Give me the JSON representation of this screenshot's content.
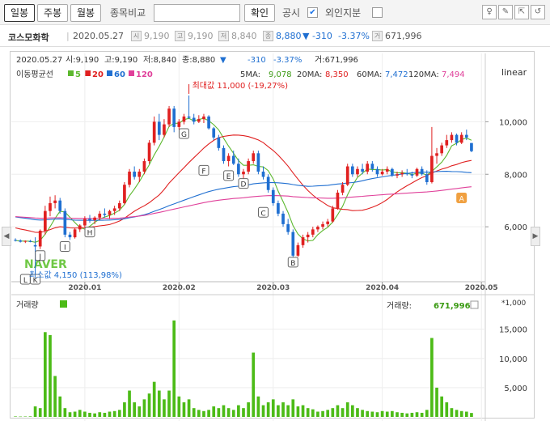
{
  "toolbar": {
    "tabs": [
      "일봉",
      "주봉",
      "월봉"
    ],
    "compare_label": "종목비교",
    "confirm_label": "확인",
    "disclosure_label": "공시",
    "foreign_label": "외인지분"
  },
  "info": {
    "name": "코스모화학",
    "date": "2020.05.27",
    "open": "9,190",
    "high": "9,190",
    "low": "8,840",
    "close": "8,880",
    "change": "▼ -310",
    "change_pct": "-3.37%",
    "volume": "671,996"
  },
  "chart_header": {
    "date": "2020.05.27",
    "open_text": "시:9,190",
    "high_text": "고:9,190",
    "low_text": "저:8,840",
    "close_text": "종:8,880",
    "arrow": "▼",
    "change": "-310",
    "change_pct": "-3.37%",
    "volume_text": "거:671,996",
    "scale_mode": "linear"
  },
  "ma_legend": {
    "title": "이동평균선",
    "items": [
      {
        "label": "5",
        "color": "#5cb82e"
      },
      {
        "label": "20",
        "color": "#e02020"
      },
      {
        "label": "60",
        "color": "#1f6fd1"
      },
      {
        "label": "120",
        "color": "#e0409a"
      }
    ],
    "values": [
      {
        "label": "5MA:",
        "value": "9,078",
        "color": "#3a9a12"
      },
      {
        "label": "20MA:",
        "value": "8,350",
        "color": "#e02020"
      },
      {
        "label": "60MA:",
        "value": "7,472",
        "color": "#1f6fd1"
      },
      {
        "label": "120MA:",
        "value": "7,494",
        "color": "#e0409a"
      }
    ]
  },
  "annotations": {
    "max_label": "최대값 11,000 (-19,27%)",
    "min_label": "최소값 4,150 (113,98%)",
    "watermark": "NAVER"
  },
  "volume_panel": {
    "title": "거래량",
    "value_label": "거래량:",
    "value": "671,996",
    "unit": "*1,000"
  },
  "chart_data": [
    {
      "type": "candlestick",
      "title": "",
      "ylim": [
        4000,
        11800
      ],
      "y_ticks": [
        6000,
        8000,
        10000
      ],
      "y_tick_labels": [
        "6,000",
        "8,000",
        "10,000"
      ],
      "x_tick_labels": [
        "2020.01",
        "2020.02",
        "2020.03",
        "2020.04",
        "2020.05"
      ],
      "x_tick_index": [
        14,
        33,
        52,
        74,
        94
      ],
      "ohlc": [
        [
          5500,
          5560,
          5440,
          5480
        ],
        [
          5480,
          5520,
          5400,
          5430
        ],
        [
          5430,
          5480,
          5380,
          5460
        ],
        [
          5460,
          5500,
          5410,
          5420
        ],
        [
          5300,
          5600,
          4150,
          5250
        ],
        [
          5250,
          5900,
          5150,
          5850
        ],
        [
          5850,
          6800,
          5700,
          6600
        ],
        [
          6600,
          7150,
          6400,
          6900
        ],
        [
          6900,
          7200,
          6700,
          7000
        ],
        [
          7000,
          7100,
          6500,
          6600
        ],
        [
          6600,
          6700,
          5600,
          5700
        ],
        [
          5700,
          5800,
          5500,
          5600
        ],
        [
          5600,
          5950,
          5550,
          5900
        ],
        [
          5900,
          6100,
          5800,
          6050
        ],
        [
          6050,
          6400,
          5950,
          6300
        ],
        [
          6300,
          6450,
          6150,
          6250
        ],
        [
          6250,
          6400,
          6100,
          6350
        ],
        [
          6350,
          6600,
          6250,
          6500
        ],
        [
          6500,
          6700,
          6350,
          6450
        ],
        [
          6450,
          6650,
          6300,
          6600
        ],
        [
          6600,
          6800,
          6450,
          6700
        ],
        [
          6700,
          7000,
          6600,
          6900
        ],
        [
          6900,
          7700,
          6850,
          7600
        ],
        [
          7600,
          8200,
          7500,
          8100
        ],
        [
          8100,
          8300,
          7800,
          7900
        ],
        [
          7900,
          8200,
          7700,
          8100
        ],
        [
          8100,
          8600,
          8000,
          8500
        ],
        [
          8500,
          9300,
          8400,
          9200
        ],
        [
          9200,
          10200,
          9100,
          10000
        ],
        [
          10000,
          10300,
          9300,
          9500
        ],
        [
          9500,
          10100,
          9400,
          9900
        ],
        [
          9900,
          10600,
          9800,
          10500
        ],
        [
          10500,
          10600,
          9600,
          9800
        ],
        [
          9800,
          10100,
          9700,
          10000
        ],
        [
          10000,
          10300,
          9900,
          10200
        ],
        [
          10200,
          11000,
          10100,
          10150
        ],
        [
          10150,
          10300,
          9900,
          10000
        ],
        [
          10000,
          10250,
          9950,
          10100
        ],
        [
          10100,
          10300,
          9950,
          10200
        ],
        [
          10200,
          10250,
          9700,
          9750
        ],
        [
          9750,
          9800,
          9300,
          9400
        ],
        [
          9400,
          9500,
          8900,
          9000
        ],
        [
          9000,
          9100,
          8400,
          8500
        ],
        [
          8500,
          8800,
          8300,
          8700
        ],
        [
          8700,
          8900,
          8350,
          8400
        ],
        [
          8400,
          8600,
          7900,
          8000
        ],
        [
          8000,
          8200,
          7800,
          8100
        ],
        [
          8100,
          8600,
          8000,
          8500
        ],
        [
          8500,
          8900,
          8400,
          8800
        ],
        [
          8800,
          8900,
          8000,
          8100
        ],
        [
          8100,
          8300,
          7800,
          7900
        ],
        [
          7900,
          8000,
          7300,
          7400
        ],
        [
          7400,
          7500,
          6800,
          6900
        ],
        [
          6900,
          7000,
          6400,
          6500
        ],
        [
          6500,
          6600,
          6000,
          6100
        ],
        [
          6100,
          6300,
          5700,
          5800
        ],
        [
          5800,
          5900,
          4800,
          4900
        ],
        [
          4900,
          5400,
          4850,
          5300
        ],
        [
          5300,
          5700,
          5200,
          5600
        ],
        [
          5600,
          5800,
          5400,
          5700
        ],
        [
          5700,
          6000,
          5600,
          5900
        ],
        [
          5900,
          6050,
          5800,
          6000
        ],
        [
          6000,
          6200,
          5900,
          6100
        ],
        [
          6100,
          6300,
          6000,
          6200
        ],
        [
          6200,
          6800,
          6150,
          6700
        ],
        [
          6700,
          7400,
          6650,
          7300
        ],
        [
          7300,
          7700,
          7200,
          7600
        ],
        [
          7600,
          8400,
          7550,
          8300
        ],
        [
          8300,
          8400,
          7900,
          8000
        ],
        [
          8000,
          8300,
          7900,
          8200
        ],
        [
          8200,
          8400,
          8000,
          8100
        ],
        [
          8100,
          8500,
          8000,
          8400
        ],
        [
          8400,
          8500,
          8100,
          8200
        ],
        [
          8200,
          8300,
          7900,
          8000
        ],
        [
          8000,
          8200,
          7950,
          8100
        ],
        [
          8100,
          8300,
          8000,
          8200
        ],
        [
          8200,
          8250,
          7900,
          7950
        ],
        [
          7950,
          8100,
          7850,
          8000
        ],
        [
          8000,
          8150,
          7900,
          8050
        ],
        [
          8050,
          8200,
          7950,
          8000
        ],
        [
          8000,
          8100,
          7850,
          7950
        ],
        [
          7950,
          8250,
          7900,
          8200
        ],
        [
          8200,
          8300,
          7950,
          8000
        ],
        [
          8000,
          8150,
          7600,
          7700
        ],
        [
          7700,
          9800,
          7650,
          8700
        ],
        [
          8700,
          9000,
          8400,
          8800
        ],
        [
          8800,
          9200,
          8700,
          9100
        ],
        [
          9100,
          9500,
          9000,
          9300
        ],
        [
          9300,
          9600,
          9200,
          9500
        ],
        [
          9500,
          9550,
          9100,
          9200
        ],
        [
          9200,
          9600,
          9150,
          9500
        ],
        [
          9500,
          9700,
          9300,
          9400
        ],
        [
          9190,
          9190,
          8840,
          8880
        ]
      ],
      "volume": [
        80,
        60,
        70,
        90,
        1800,
        1500,
        14500,
        14000,
        7000,
        3500,
        1500,
        800,
        900,
        1200,
        900,
        700,
        600,
        800,
        700,
        900,
        1000,
        1200,
        2500,
        4500,
        2500,
        1800,
        3000,
        4000,
        6000,
        4500,
        3000,
        4500,
        16500,
        3500,
        2500,
        3000,
        1500,
        1200,
        1000,
        1200,
        1800,
        1500,
        2000,
        1500,
        1200,
        2000,
        1500,
        2500,
        11000,
        3500,
        2000,
        2500,
        3000,
        2000,
        2500,
        2000,
        3000,
        1800,
        2000,
        1500,
        1300,
        900,
        1000,
        1200,
        1500,
        2000,
        1500,
        2500,
        2000,
        1500,
        1200,
        1000,
        900,
        800,
        1000,
        900,
        1000,
        800,
        700,
        600,
        700,
        800,
        700,
        1200,
        13500,
        5000,
        3500,
        2500,
        1500,
        1200,
        1000,
        900,
        672
      ],
      "volume_ylim": [
        0,
        18000
      ],
      "volume_ticks": [
        5000,
        10000,
        15000
      ],
      "volume_tick_labels": [
        "5,000",
        "10,000",
        "15,000"
      ],
      "markers": [
        {
          "label": "A",
          "index": 90,
          "y": 7100,
          "filled": true
        },
        {
          "label": "B",
          "index": 56,
          "y": 4650,
          "filled": false
        },
        {
          "label": "C",
          "index": 50,
          "y": 6550,
          "filled": false
        },
        {
          "label": "D",
          "index": 46,
          "y": 7650,
          "filled": false
        },
        {
          "label": "E",
          "index": 43,
          "y": 7950,
          "filled": false
        },
        {
          "label": "F",
          "index": 38,
          "y": 8150,
          "filled": false
        },
        {
          "label": "G",
          "index": 34,
          "y": 9550,
          "filled": false
        },
        {
          "label": "H",
          "index": 15,
          "y": 5800,
          "filled": false
        },
        {
          "label": "I",
          "index": 10,
          "y": 5250,
          "filled": false
        },
        {
          "label": "J",
          "index": 5,
          "y": 4900,
          "filled": false
        },
        {
          "label": "K",
          "index": 4,
          "y": 4000,
          "filled": false
        },
        {
          "label": "L",
          "index": 2,
          "y": 4000,
          "filled": false
        }
      ],
      "max_point": {
        "index": 35,
        "value": 11000
      },
      "min_point": {
        "index": 4,
        "value": 4150
      },
      "up_color": "#e02020",
      "down_color": "#1f6fd1",
      "volume_color": "#4cbb17"
    }
  ]
}
